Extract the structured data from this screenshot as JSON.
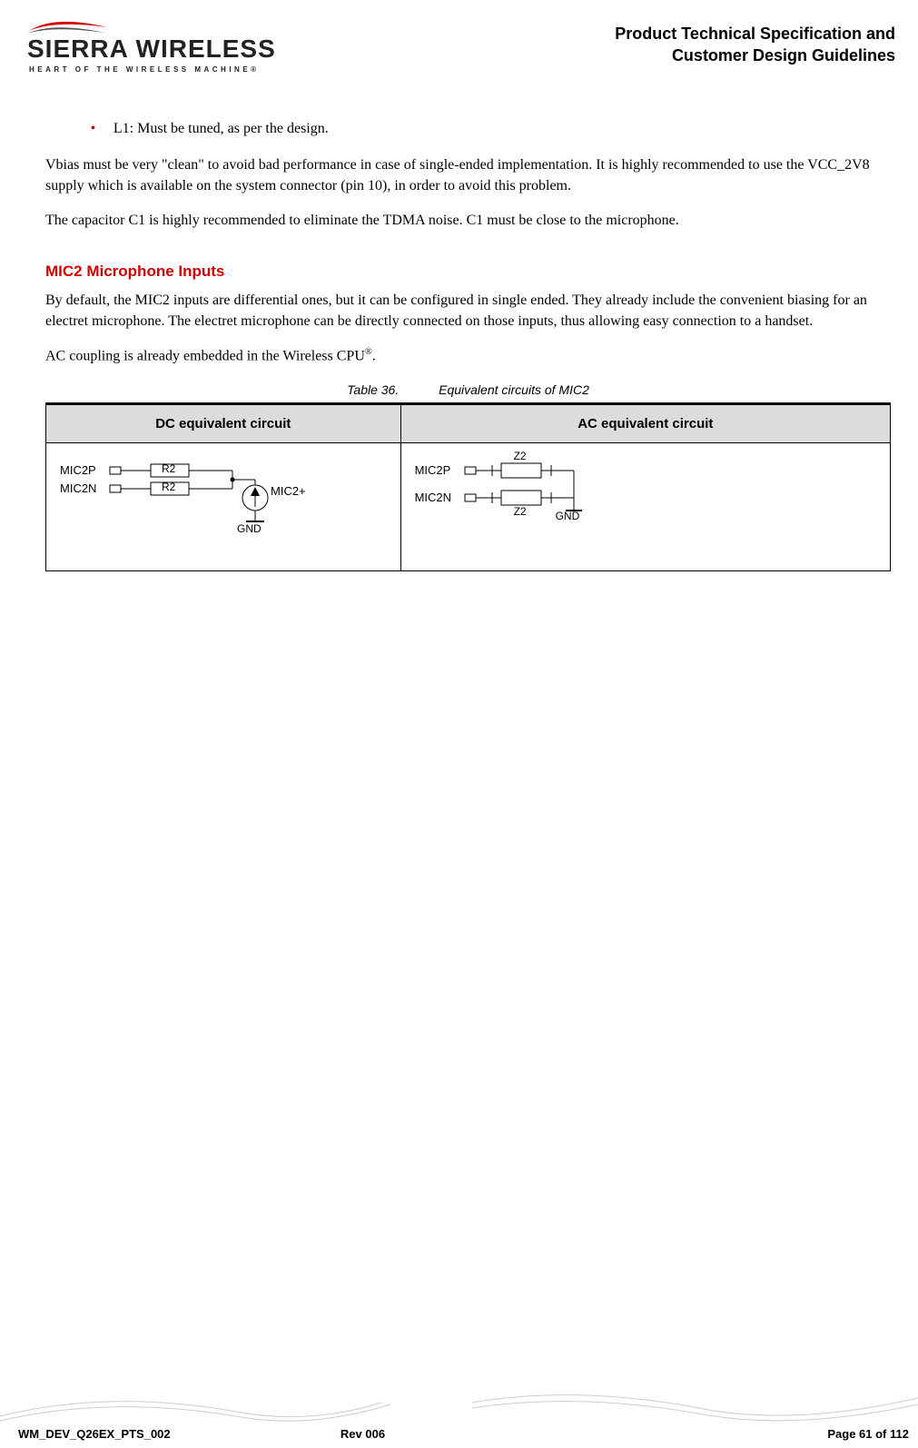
{
  "header": {
    "brand_main": "SIERRA WIRELESS",
    "brand_sub": "HEART OF THE WIRELESS MACHINE®",
    "doc_title_line1": "Product Technical Specification and",
    "doc_title_line2": "Customer Design Guidelines"
  },
  "body": {
    "bullet1": "L1: Must be tuned, as per the design.",
    "para1": "Vbias must be very \"clean\" to avoid bad performance in case of single-ended implementation. It is highly recommended to use the VCC_2V8 supply which is available on the system connector (pin 10), in order to avoid this problem.",
    "para2": "The capacitor C1 is highly recommended to eliminate the TDMA noise. C1 must be close to the microphone.",
    "section_title": "MIC2 Microphone Inputs",
    "para3": "By default, the MIC2 inputs are differential ones, but it can be configured in single ended. They already include the convenient biasing for an electret microphone. The electret microphone can be directly connected on those inputs, thus allowing easy connection to a handset.",
    "para4_pre": "AC coupling is already embedded in the Wireless CPU",
    "para4_sup": "®",
    "para4_post": ".",
    "table_caption_num": "Table 36.",
    "table_caption_txt": "Equivalent circuits of MIC2",
    "table": {
      "col1_header": "DC equivalent circuit",
      "col2_header": "AC equivalent circuit"
    },
    "dc": {
      "mic2p": "MIC2P",
      "mic2n": "MIC2N",
      "r2": "R2",
      "mic2plus": "MIC2+",
      "gnd": "GND"
    },
    "ac": {
      "mic2p": "MIC2P",
      "mic2n": "MIC2N",
      "z2": "Z2",
      "gnd": "GND"
    }
  },
  "footer": {
    "doc_id": "WM_DEV_Q26EX_PTS_002",
    "rev": "Rev 006",
    "page": "Page 61 of 112"
  },
  "chart_data": {
    "type": "table",
    "title": "Equivalent circuits of MIC2",
    "columns": [
      "DC equivalent circuit",
      "AC equivalent circuit"
    ],
    "rows": [
      {
        "DC equivalent circuit": "MIC2P and MIC2N each through resistor R2 to node; node connects to current source (MIC2+) to GND",
        "AC equivalent circuit": "MIC2P and MIC2N each through impedance Z2 to common node tied to GND"
      }
    ]
  }
}
